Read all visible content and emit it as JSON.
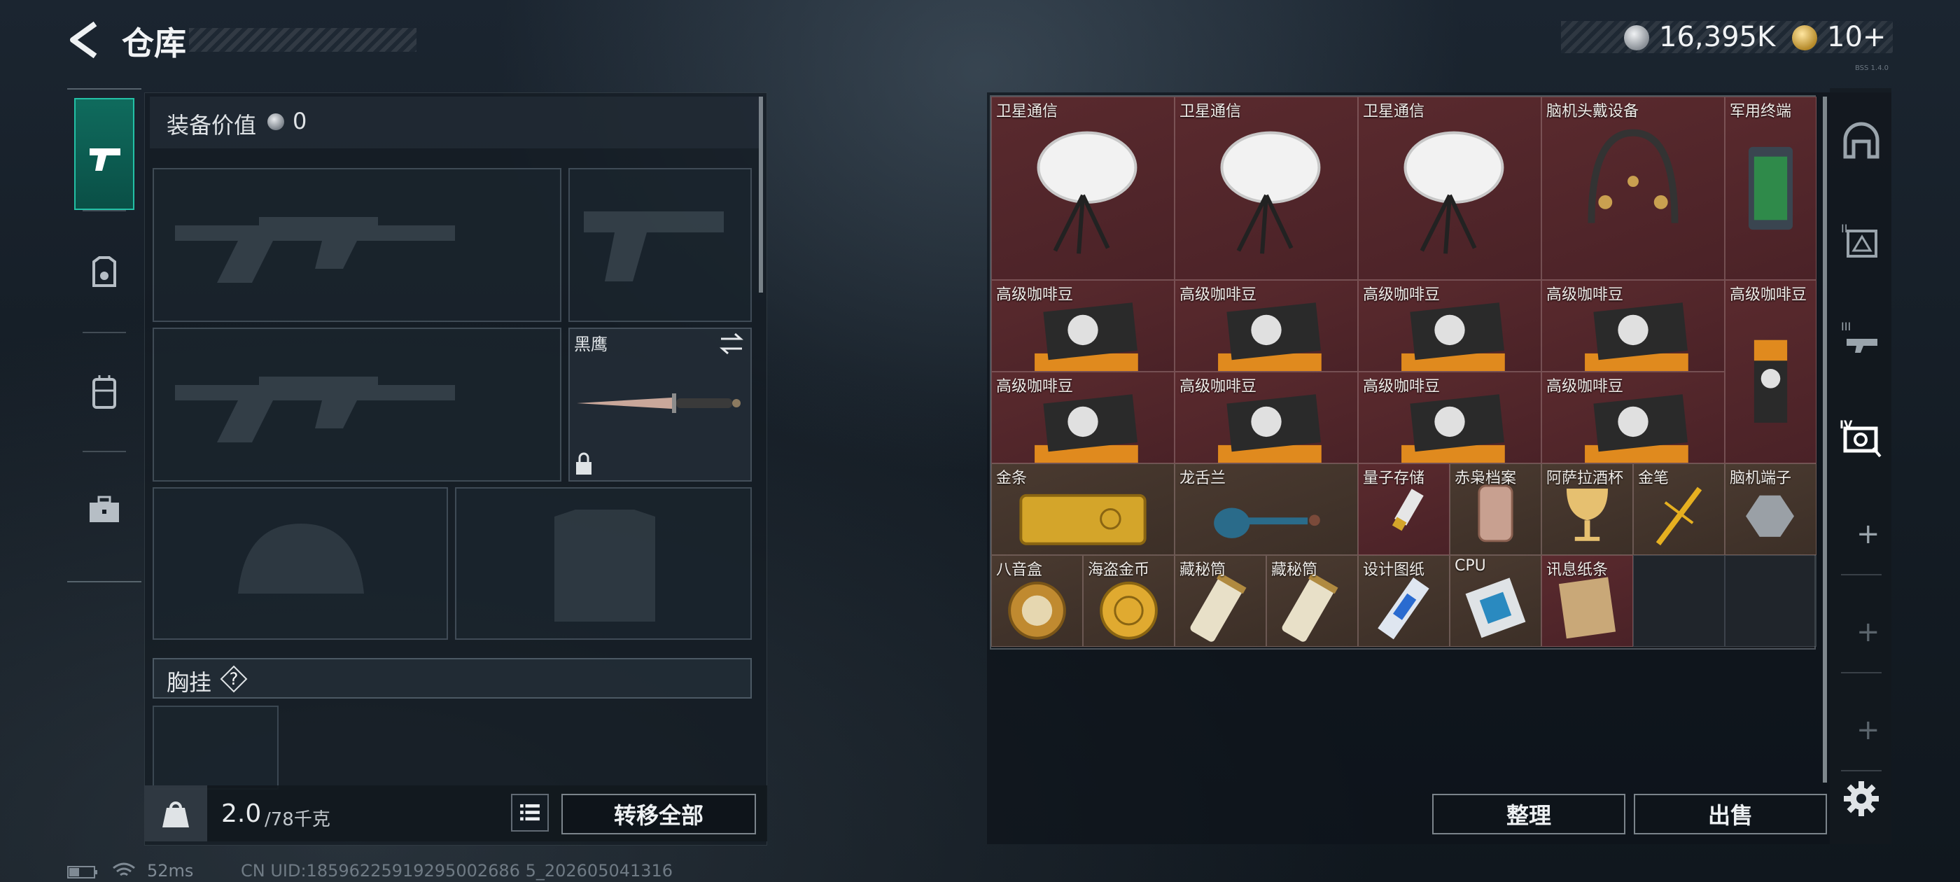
{
  "header": {
    "title": "仓库",
    "currency": [
      {
        "name": "silver",
        "amount": "16,395K"
      },
      {
        "name": "gold",
        "amount": "10+"
      }
    ],
    "version": "BSS 1.4.0"
  },
  "sidebar": {
    "tabs": [
      {
        "icon": "pistol-icon",
        "active": true
      },
      {
        "icon": "armor-vest-icon",
        "active": false
      },
      {
        "icon": "backpack-icon",
        "active": false
      },
      {
        "icon": "toolbox-icon",
        "active": false
      }
    ]
  },
  "equipment": {
    "value_label": "装备价值",
    "value_amount": "0",
    "melee_name": "黑鹰",
    "chest_rig_label": "胸挂",
    "help_glyph": "?"
  },
  "weight": {
    "current": "2.0",
    "max": "/78千克"
  },
  "actions": {
    "transfer_all": "转移全部",
    "organize": "整理",
    "sell": "出售"
  },
  "status": {
    "ping": "52ms",
    "uid": "CN UID:18596225919295002686 5_202605041316"
  },
  "storage": {
    "items": [
      {
        "name": "卫星通信",
        "rarity": "red",
        "icon": "satellite-dish"
      },
      {
        "name": "卫星通信",
        "rarity": "red",
        "icon": "satellite-dish"
      },
      {
        "name": "卫星通信",
        "rarity": "red",
        "icon": "satellite-dish"
      },
      {
        "name": "脑机头戴设备",
        "rarity": "red",
        "icon": "headset"
      },
      {
        "name": "军用终端",
        "rarity": "red",
        "icon": "military-terminal"
      },
      {
        "name": "高级咖啡豆",
        "rarity": "red",
        "icon": "coffee-bag"
      },
      {
        "name": "高级咖啡豆",
        "rarity": "red",
        "icon": "coffee-bag"
      },
      {
        "name": "高级咖啡豆",
        "rarity": "red",
        "icon": "coffee-bag"
      },
      {
        "name": "高级咖啡豆",
        "rarity": "red",
        "icon": "coffee-bag"
      },
      {
        "name": "高级咖啡豆",
        "rarity": "red",
        "icon": "coffee-bag-tall"
      },
      {
        "name": "高级咖啡豆",
        "rarity": "red",
        "icon": "coffee-bag"
      },
      {
        "name": "高级咖啡豆",
        "rarity": "red",
        "icon": "coffee-bag"
      },
      {
        "name": "高级咖啡豆",
        "rarity": "red",
        "icon": "coffee-bag"
      },
      {
        "name": "高级咖啡豆",
        "rarity": "red",
        "icon": "coffee-bag"
      },
      {
        "name": "金条",
        "rarity": "brown",
        "icon": "gold-bar"
      },
      {
        "name": "龙舌兰",
        "rarity": "brown",
        "icon": "tequila"
      },
      {
        "name": "量子存储",
        "rarity": "red",
        "icon": "usb-drive"
      },
      {
        "name": "赤枭档案",
        "rarity": "brown",
        "icon": "archive-jar"
      },
      {
        "name": "阿萨拉酒杯",
        "rarity": "brown",
        "icon": "goblet"
      },
      {
        "name": "金笔",
        "rarity": "brown",
        "icon": "gold-pen"
      },
      {
        "name": "脑机端子",
        "rarity": "brown",
        "icon": "bci-terminal"
      },
      {
        "name": "八音盒",
        "rarity": "brown",
        "icon": "music-box"
      },
      {
        "name": "海盗金币",
        "rarity": "brown",
        "icon": "gold-coin"
      },
      {
        "name": "藏秘筒",
        "rarity": "brown",
        "icon": "cryptex"
      },
      {
        "name": "藏秘筒",
        "rarity": "brown",
        "icon": "cryptex"
      },
      {
        "name": "设计图纸",
        "rarity": "brown",
        "icon": "blueprint"
      },
      {
        "name": "CPU",
        "rarity": "brown",
        "icon": "cpu-chip"
      },
      {
        "name": "讯息纸条",
        "rarity": "red",
        "icon": "message-paper"
      }
    ]
  },
  "right_tabs": {
    "shelves": [
      "I",
      "II",
      "III",
      "IV",
      "+",
      "+",
      "+"
    ]
  },
  "colors": {
    "active_tab": "#0f6b5d",
    "red_rarity": "#5a2a2e",
    "brown_rarity": "#4a3a30"
  }
}
